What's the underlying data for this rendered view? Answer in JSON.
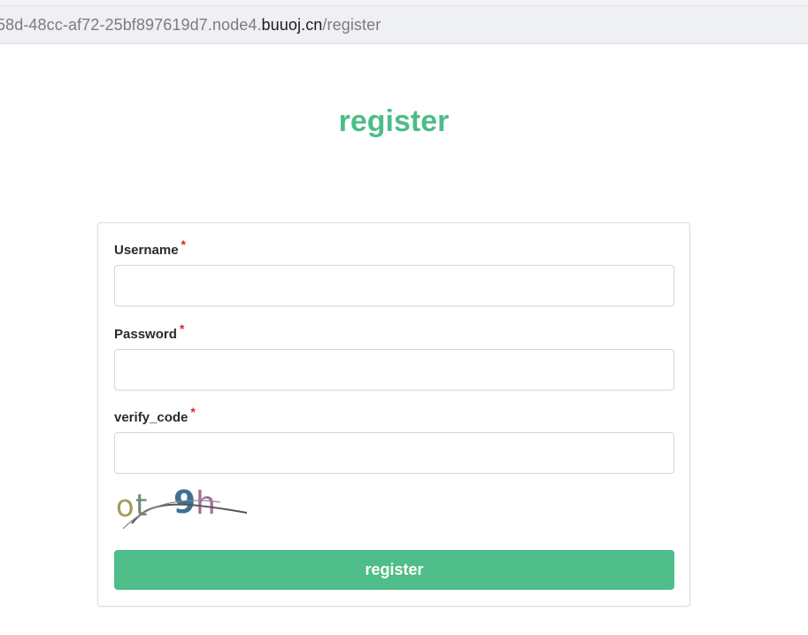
{
  "browser": {
    "url_prefix": "58d-48cc-af72-25bf897619d7.node4.",
    "url_domain": "buuoj.cn",
    "url_path": "/register"
  },
  "page": {
    "title": "register"
  },
  "form": {
    "username": {
      "label": "Username",
      "required_mark": "*",
      "value": "",
      "placeholder": ""
    },
    "password": {
      "label": "Password",
      "required_mark": "*",
      "value": "",
      "placeholder": ""
    },
    "verify_code": {
      "label": "verify_code",
      "required_mark": "*",
      "value": "",
      "placeholder": ""
    },
    "captcha_text": "ot 9h",
    "submit_label": "register"
  },
  "colors": {
    "accent": "#4fbd89",
    "required": "#d9262c"
  }
}
